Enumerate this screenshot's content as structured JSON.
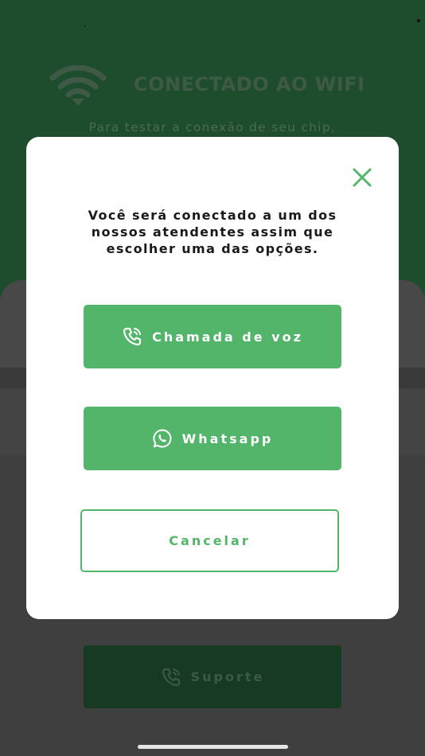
{
  "background": {
    "wifi_title": "CONECTADO AO WIFI",
    "wifi_subtitle": "Para testar a conexão de seu chip,",
    "support_label": "Suporte"
  },
  "modal": {
    "message": "Você será conectado a um dos nossos atendentes assim que escolher uma das opções.",
    "voice_call_label": "Chamada de voz",
    "whatsapp_label": "Whatsapp",
    "cancel_label": "Cancelar"
  },
  "colors": {
    "accent_green": "#52b56a",
    "dark_green": "#1d4d2c",
    "modal_bg": "#ffffff"
  },
  "icons": {
    "close": "close-icon",
    "voice_call": "phone-call-icon",
    "whatsapp": "whatsapp-icon",
    "wifi": "wifi-icon",
    "support": "phone-call-icon"
  }
}
